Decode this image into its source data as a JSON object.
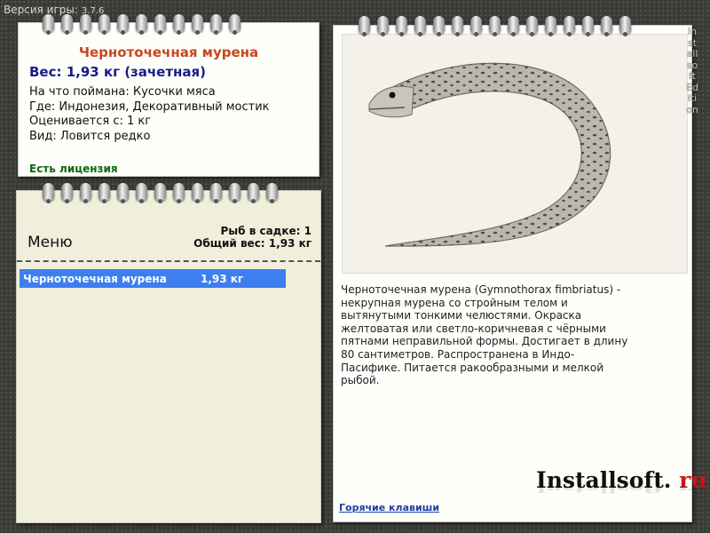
{
  "header": {
    "version_label": "Версия игры:",
    "version_number": "3.7.6"
  },
  "fish": {
    "title": "Черноточечная мурена",
    "weight_line": "Вес: 1,93 кг (зачетная)",
    "bait": "На что поймана: Кусочки мяса",
    "place": "Где: Индонезия, Декоративный мостик",
    "rated": "Оценивается с: 1 кг",
    "kind": "Вид: Ловится редко",
    "license": "Есть лицензия"
  },
  "menu": {
    "title": "Меню",
    "fish_count": "Рыб в садке: 1",
    "total_weight": "Общий вес: 1,93 кг",
    "rows": [
      {
        "name": "Черноточечная мурена",
        "weight": "1,93 кг"
      }
    ]
  },
  "detail": {
    "description": "Черноточечная мурена (Gymnothorax fimbriatus) - некрупная мурена со стройным телом и вытянутыми тонкими челюстями. Окраска желтоватая или светло-коричневая с чёрными пятнами неправильной формы. Достигает в длину 80 сантиметров. Распространена в Индо-Пасифике. Питается ракообразными и мелкой рыбой.",
    "hotkeys": "Горячие клавиши",
    "logo_main": "Installsoft.",
    "logo_ru": "ru"
  },
  "side_text": "Installsoft Edition",
  "colors": {
    "accent_title": "#c8461e",
    "weight": "#1a1a8c",
    "license": "#0a6b0a",
    "selection": "#3d7ef0",
    "link": "#1a3fa8"
  }
}
